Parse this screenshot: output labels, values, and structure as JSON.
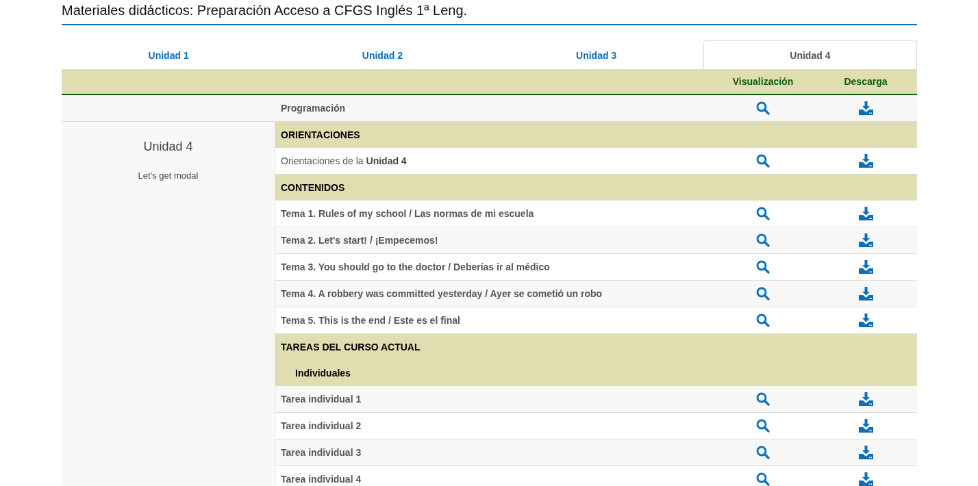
{
  "page_title": "Materiales didácticos: Preparación Acceso a CFGS Inglés 1ª Leng.",
  "tabs": [
    {
      "label": "Unidad 1",
      "selected": false
    },
    {
      "label": "Unidad 2",
      "selected": false
    },
    {
      "label": "Unidad 3",
      "selected": false
    },
    {
      "label": "Unidad 4",
      "selected": true
    }
  ],
  "table": {
    "columns": [
      "Visualización",
      "Descarga"
    ],
    "top_row": {
      "text": "Programación",
      "bold": true
    },
    "sidebar": {
      "title": "Unidad 4",
      "subtitle": "Let's get modal"
    },
    "rows": [
      {
        "kind": "section",
        "text": "ORIENTACIONES"
      },
      {
        "kind": "item",
        "text": "Orientaciones de la **Unidad 4**",
        "bold": false
      },
      {
        "kind": "section",
        "text": "CONTENIDOS"
      },
      {
        "kind": "item",
        "text": "Tema 1. Rules of my school / Las normas de mi escuela",
        "bold": true
      },
      {
        "kind": "item",
        "text": "Tema 2. Let's start! / ¡Empecemos!",
        "bold": true
      },
      {
        "kind": "item",
        "text": "Tema 3. You should go to the doctor / Deberías ir al médico",
        "bold": true
      },
      {
        "kind": "item",
        "text": "Tema 4. A robbery was committed yesterday / Ayer se cometió un robo",
        "bold": true
      },
      {
        "kind": "item",
        "text": "Tema 5. This is the end / Este es el final",
        "bold": true
      },
      {
        "kind": "section",
        "text": "TAREAS DEL CURSO ACTUAL"
      },
      {
        "kind": "subsection",
        "text": "Individuales"
      },
      {
        "kind": "item",
        "text": "Tarea individual 1",
        "bold": true
      },
      {
        "kind": "item",
        "text": "Tarea individual 2",
        "bold": true
      },
      {
        "kind": "item",
        "text": "Tarea individual 3",
        "bold": true
      },
      {
        "kind": "item",
        "text": "Tarea individual 4",
        "bold": true
      }
    ]
  }
}
